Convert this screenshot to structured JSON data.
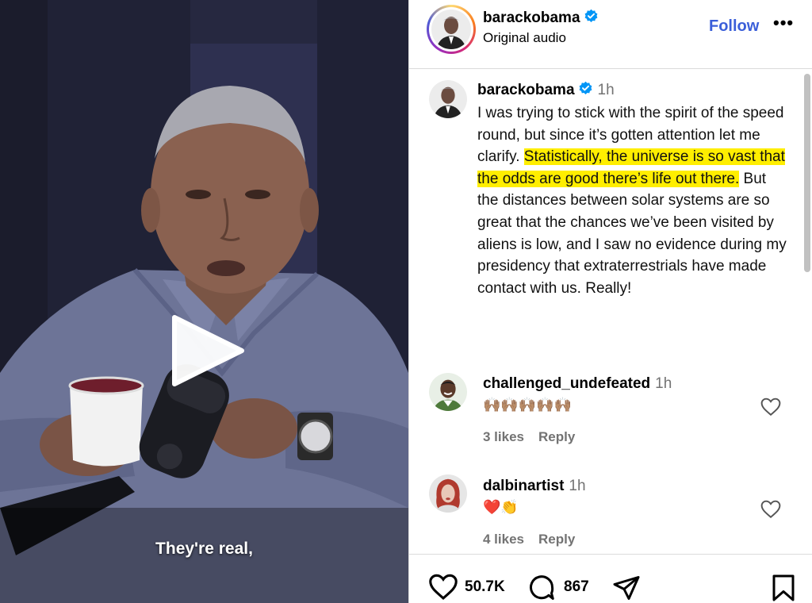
{
  "video": {
    "subtitle": "They're real,"
  },
  "post": {
    "username": "barackobama",
    "audio_label": "Original audio",
    "follow_label": "Follow",
    "more_icon": "•••",
    "caption": {
      "username": "barackobama",
      "time": "1h",
      "text_part1": "I was trying to stick with the spirit of the speed round, but since it’s gotten attention let me clarify. ",
      "text_highlight": "Statistically, the universe is so vast that the odds are good there’s life out there.",
      "text_part2": " But the distances between solar systems are so great that the chances we’ve been visited by aliens is low, and I saw no evidence during my presidency that extraterrestrials have made contact with us. Really!"
    },
    "comments": [
      {
        "username": "challenged_undefeated",
        "time": "1h",
        "text": "🙌🏽🙌🏽🙌🏽🙌🏽🙌🏽",
        "likes": "3 likes",
        "reply": "Reply"
      },
      {
        "username": "dalbinartist",
        "time": "1h",
        "text": "❤️👏",
        "likes": "4 likes",
        "reply": "Reply"
      }
    ],
    "like_count": "50.7K",
    "comment_count": "867"
  },
  "icons": {
    "verified": "verified-badge-icon",
    "heart": "heart-icon",
    "comment": "comment-icon",
    "share": "share-icon",
    "save": "bookmark-icon",
    "play": "play-icon"
  },
  "colors": {
    "accent": "#3b5fd9",
    "verified": "#0095f6",
    "highlight": "#ffee00"
  }
}
